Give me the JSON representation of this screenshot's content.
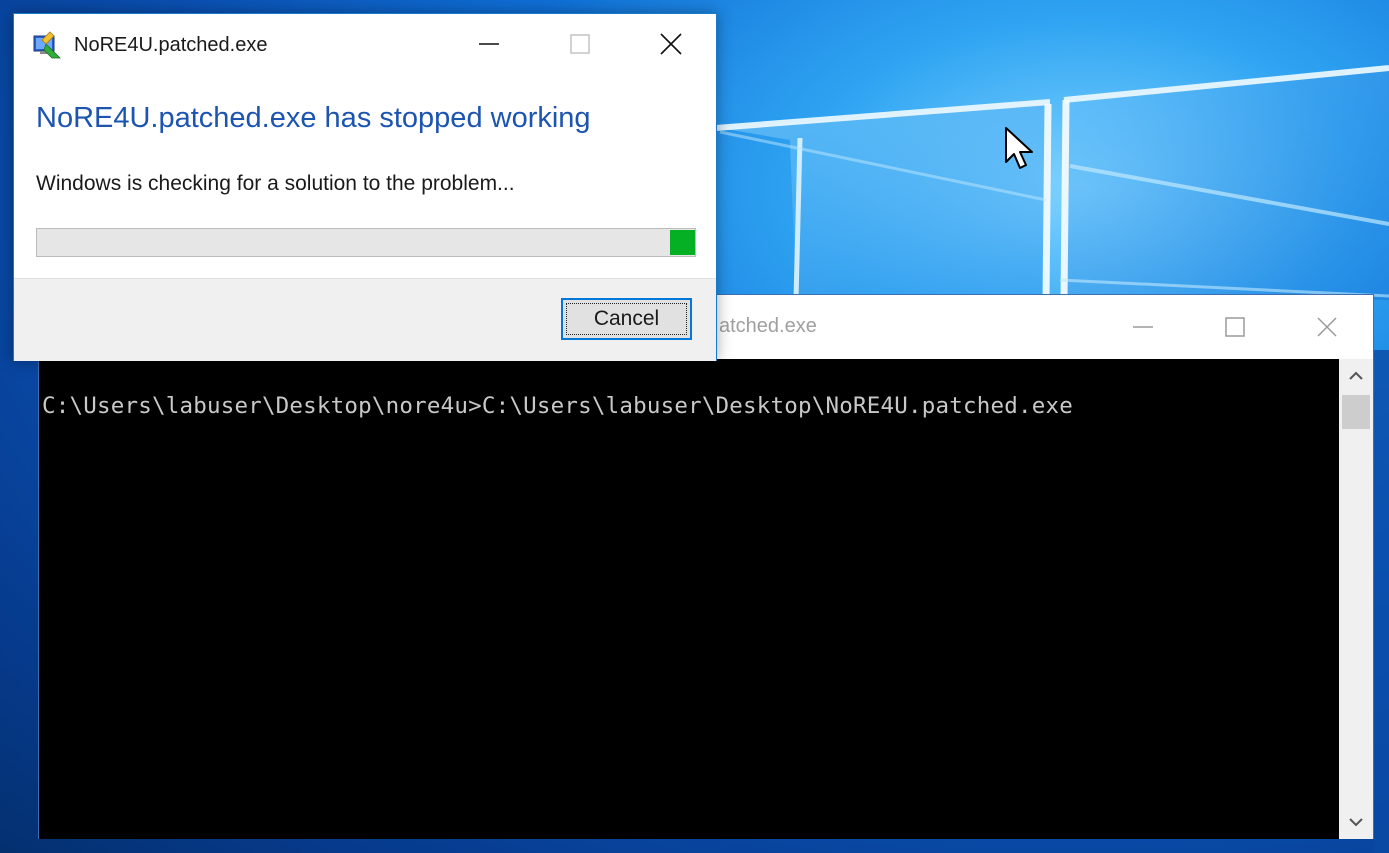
{
  "colors": {
    "dialog_heading": "#1c54b0",
    "progress_fill": "#06b025",
    "focus_border": "#0078d7",
    "console_bg": "#000000",
    "console_text": "#c8c8c8"
  },
  "console": {
    "title": "atched.exe",
    "line": "C:\\Users\\labuser\\Desktop\\nore4u>C:\\Users\\labuser\\Desktop\\NoRE4U.patched.exe",
    "minimize_icon": "minimize-icon",
    "maximize_icon": "maximize-icon",
    "close_icon": "close-icon"
  },
  "dialog": {
    "title": "NoRE4U.patched.exe",
    "heading": "NoRE4U.patched.exe has stopped working",
    "message": "Windows is checking for a solution to the problem...",
    "progress": {
      "fill_start": 0.962,
      "fill_end": 1.0
    },
    "cancel_label": "Cancel",
    "app_icon": "problem-reporting-icon"
  },
  "cursor": {
    "icon": "arrow-cursor-icon"
  }
}
